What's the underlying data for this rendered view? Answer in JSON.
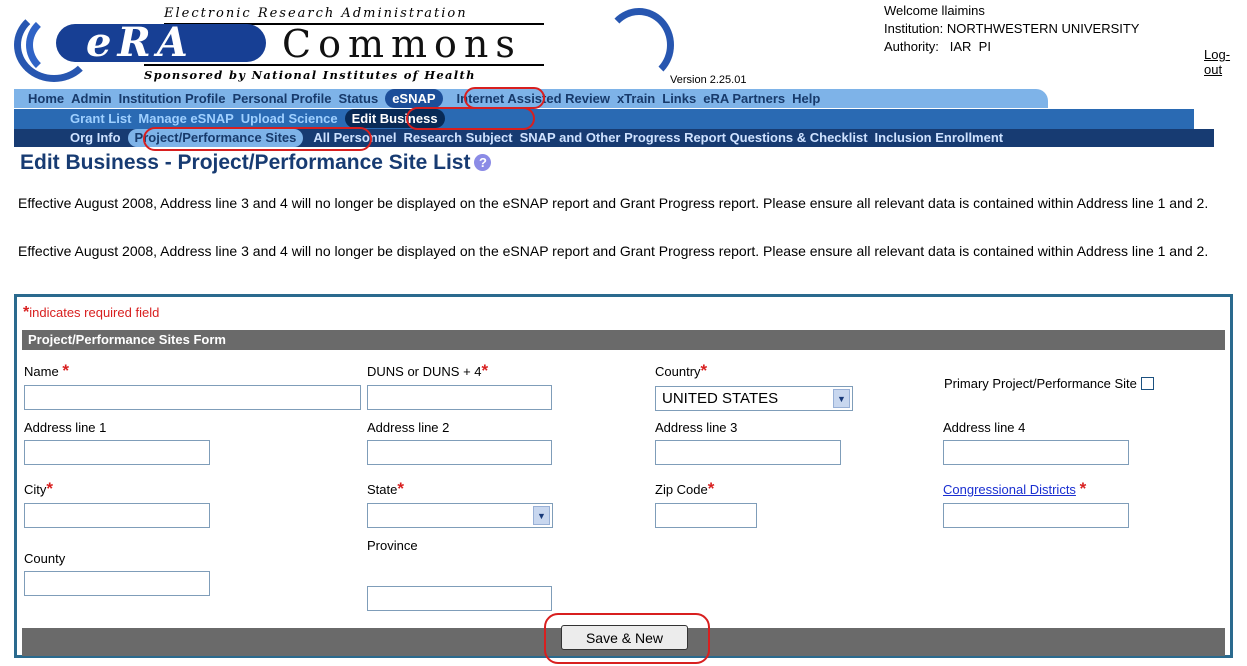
{
  "header": {
    "tagline": "Electronic Research Administration",
    "era": "eRA",
    "commons": "Commons",
    "sponsored": "Sponsored by National Institutes of Health",
    "version": "Version 2.25.01"
  },
  "user": {
    "welcome": "Welcome llaimins",
    "institution": "Institution: NORTHWESTERN UNIVERSITY",
    "authority": "Authority:   IAR  PI",
    "logout": "Log-out"
  },
  "nav_primary": [
    "Home",
    "Admin",
    "Institution Profile",
    "Personal Profile",
    "Status",
    "eSNAP",
    "Internet Assisted Review",
    "xTrain",
    "Links",
    "eRA Partners",
    "Help"
  ],
  "nav_secondary": [
    "Grant List",
    "Manage eSNAP",
    "Upload Science",
    "Edit Business"
  ],
  "nav_tertiary": [
    "Org Info",
    "Project/Performance Sites",
    "All Personnel",
    "Research Subject",
    "SNAP and Other Progress Report Questions & Checklist",
    "Inclusion Enrollment"
  ],
  "page": {
    "title": "Edit Business - Project/Performance Site List",
    "notice1": "Effective August 2008, Address line 3 and 4 will no longer be displayed on the eSNAP report and Grant Progress report. Please ensure all relevant data is contained within Address line 1 and 2.",
    "notice2": "Effective August 2008, Address line 3 and 4 will no longer be displayed on the eSNAP report and Grant Progress report. Please ensure all relevant data is contained within Address line 1 and 2."
  },
  "form": {
    "required_star": "*",
    "required_note": "indicates required field",
    "header": "Project/Performance Sites Form",
    "name_label": "Name",
    "duns_label": "DUNS or DUNS + 4",
    "country_label": "Country",
    "country_value": "UNITED STATES",
    "primary_label": "Primary Project/Performance Site",
    "addr1_label": "Address line 1",
    "addr2_label": "Address line 2",
    "addr3_label": "Address line 3",
    "addr4_label": "Address line 4",
    "city_label": "City",
    "state_label": "State",
    "state_value": "",
    "zip_label": "Zip Code",
    "cong_label": "Congressional Districts",
    "county_label": "County",
    "province_label": "Province",
    "save_new": "Save & New"
  },
  "colors": {
    "nav_primary_bg": "#7eb3e8",
    "nav_secondary_bg": "#2a6ab3",
    "nav_tertiary_bg": "#173b72",
    "required_red": "#d81f1f",
    "highlight_circle": "#d81f1f",
    "form_border": "#2a6a8e"
  }
}
